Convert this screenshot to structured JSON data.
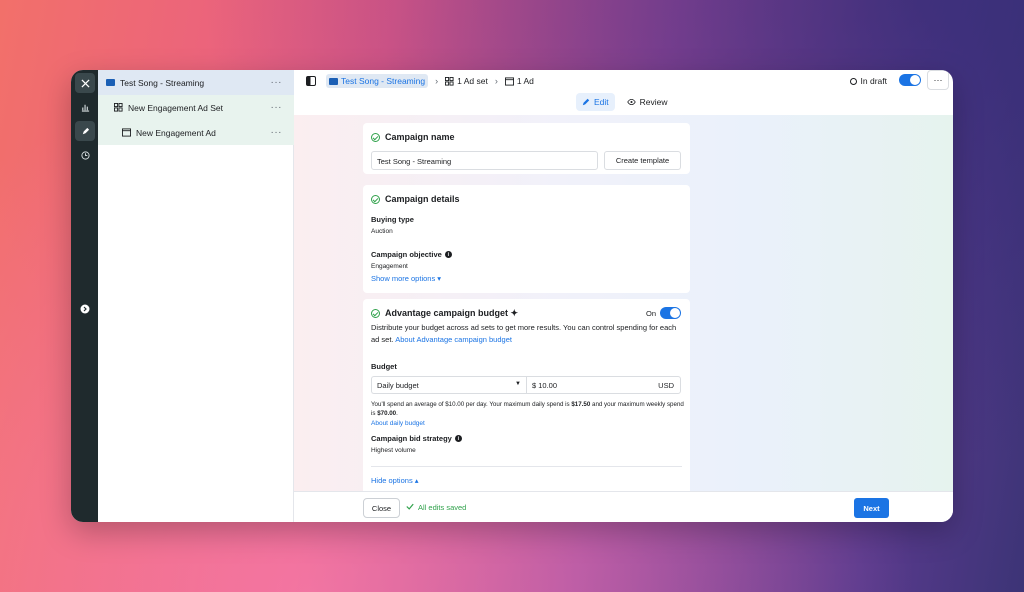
{
  "colors": {
    "accent": "#1b74e4",
    "success": "#31a24c",
    "rail": "#1f2a2d"
  },
  "rail": {
    "close_icon": "close-icon",
    "chart_icon": "bar-chart-icon",
    "edit_icon": "pencil-icon",
    "history_icon": "clock-icon",
    "expand_icon": "chevron-right-icon"
  },
  "tree": {
    "campaign": {
      "label": "Test Song - Streaming",
      "more": "···"
    },
    "adset": {
      "label": "New Engagement Ad Set",
      "more": "···"
    },
    "ad": {
      "label": "New Engagement Ad",
      "more": "···"
    }
  },
  "breadcrumb": {
    "campaign": "Test Song - Streaming",
    "adset": "1 Ad set",
    "ad": "1 Ad",
    "sep": "›"
  },
  "status": {
    "label": "In draft",
    "more": "···"
  },
  "modes": {
    "edit": "Edit",
    "review": "Review"
  },
  "campaign_name": {
    "title": "Campaign name",
    "value": "Test Song - Streaming",
    "template_button": "Create template"
  },
  "campaign_details": {
    "title": "Campaign details",
    "buying_type_label": "Buying type",
    "buying_type_value": "Auction",
    "objective_label": "Campaign objective",
    "objective_value": "Engagement",
    "show_more": "Show more options ▾"
  },
  "budget_card": {
    "title": "Advantage campaign budget ✦",
    "toggle_label": "On",
    "description": "Distribute your budget across ad sets to get more results. You can control spending for each ad set. ",
    "about_link": "About Advantage campaign budget",
    "budget_label": "Budget",
    "budget_type": "Daily budget",
    "caret": "▼",
    "amount": "$ 10.00",
    "currency": "USD",
    "spend_text_1": "You'll spend an average of $10.00 per day. Your maximum daily spend is ",
    "spend_max_daily": "$17.50",
    "spend_text_2": " and your maximum weekly spend is ",
    "spend_max_weekly": "$70.00",
    "spend_text_3": ".",
    "about_daily": "About daily budget",
    "bid_label": "Campaign bid strategy",
    "bid_value": "Highest volume",
    "hide_options": "Hide options ▴"
  },
  "footer": {
    "close": "Close",
    "saved": "All edits saved",
    "next": "Next"
  }
}
